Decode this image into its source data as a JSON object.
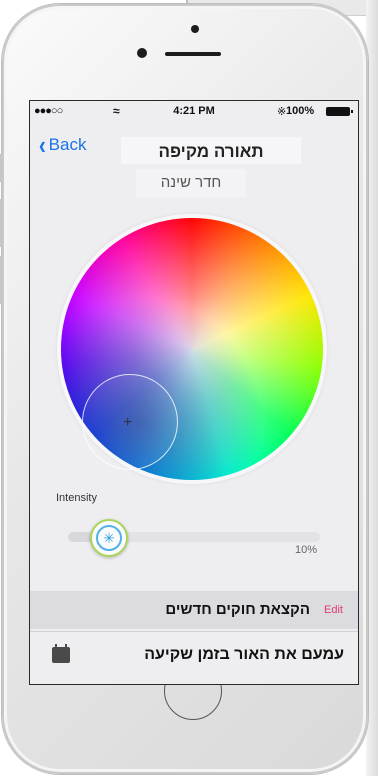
{
  "status_bar": {
    "carrier": "●●●○○",
    "wifi_icon": "wifi-icon",
    "time": "4:21 PM",
    "bluetooth_icon": "bluetooth-icon",
    "battery": "100%"
  },
  "navbar": {
    "back_label": "Back",
    "title": "תאורה מקיפה"
  },
  "room_name": "חדר שינה",
  "color_wheel": {
    "selected_marker": "+"
  },
  "intensity": {
    "label": "Intensity",
    "value_text": "10%",
    "value": 0.1,
    "knob_icon": "✳"
  },
  "rules_section": {
    "title": "הקצאת חוקים חדשים",
    "edit_label": "Edit"
  },
  "rule_item": {
    "title": "עמעם את האור בזמן שקיעה",
    "icon": "calendar-icon"
  },
  "colors": {
    "accent": "#1a73e8",
    "edit": "#e0396b",
    "knob_ring": "#a9d65a"
  }
}
